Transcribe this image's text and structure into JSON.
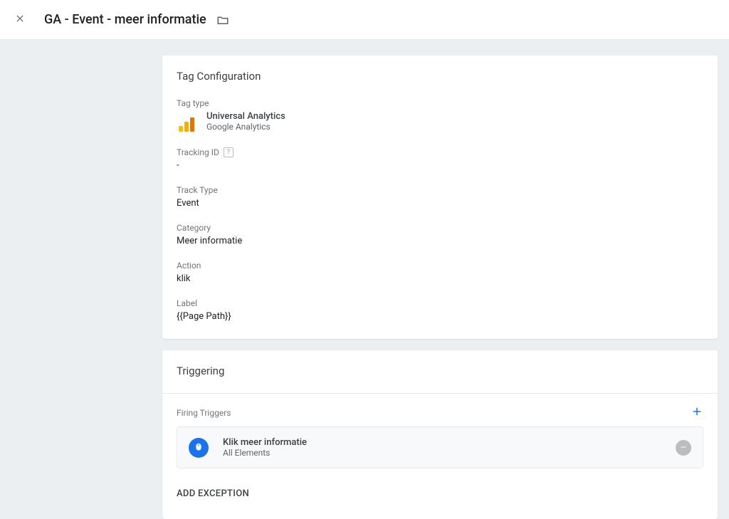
{
  "header": {
    "title": "GA - Event - meer informatie"
  },
  "tagConfig": {
    "cardTitle": "Tag Configuration",
    "tagTypeLabel": "Tag type",
    "tagTypeName": "Universal Analytics",
    "tagTypeVendor": "Google Analytics",
    "trackingIdLabel": "Tracking ID",
    "trackingIdValue": "-",
    "trackTypeLabel": "Track Type",
    "trackTypeValue": "Event",
    "categoryLabel": "Category",
    "categoryValue": "Meer informatie",
    "actionLabel": "Action",
    "actionValue": "klik",
    "labelLabel": "Label",
    "labelValue": "{{Page Path}}"
  },
  "triggering": {
    "cardTitle": "Triggering",
    "firingTriggersLabel": "Firing Triggers",
    "trigger": {
      "name": "Klik meer informatie",
      "type": "All Elements"
    },
    "addExceptionLabel": "ADD EXCEPTION"
  }
}
